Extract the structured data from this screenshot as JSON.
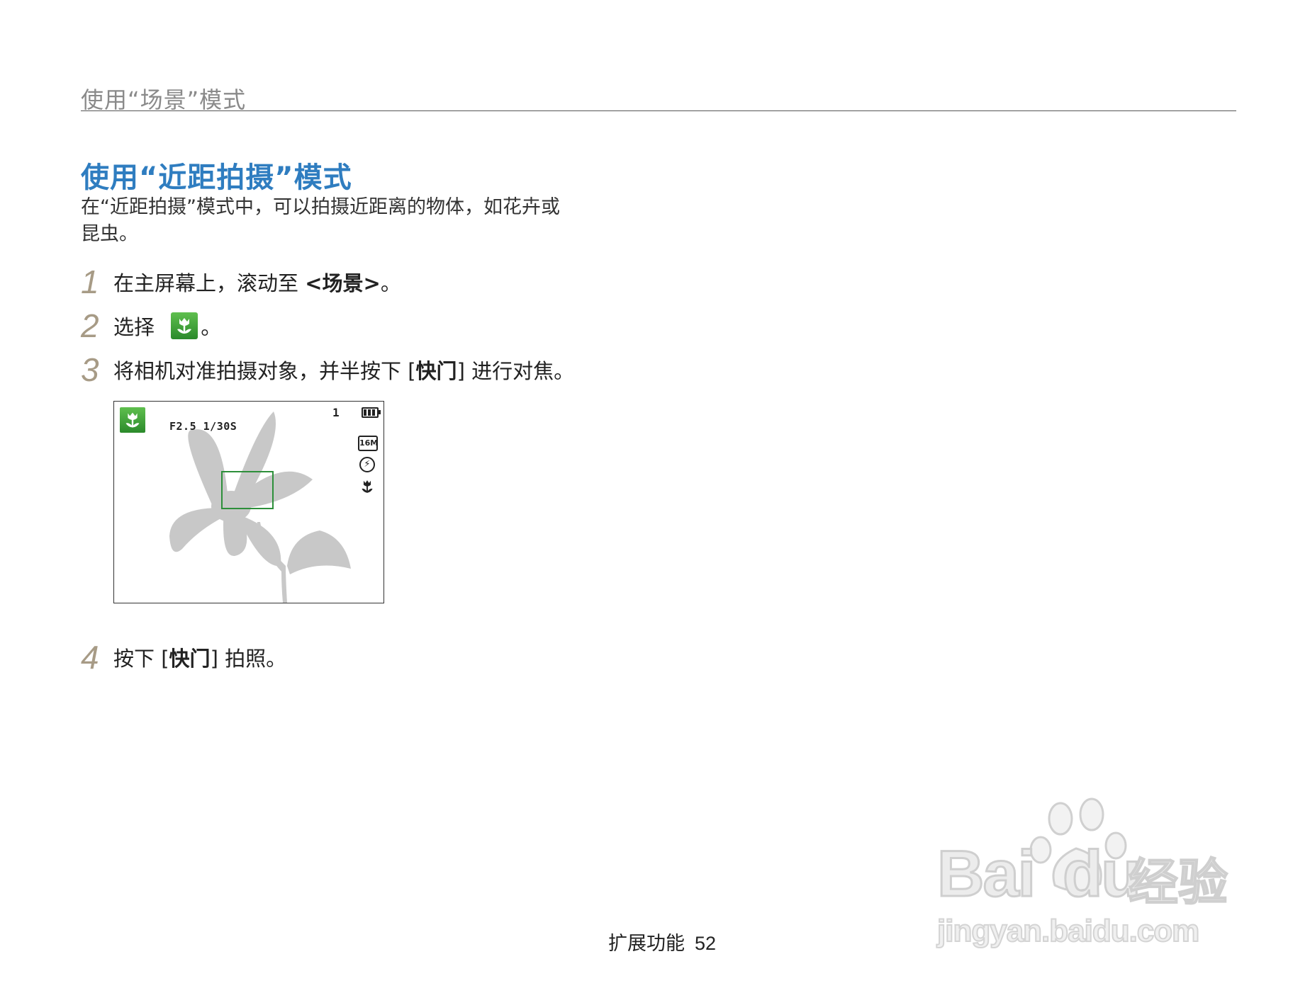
{
  "header": {
    "title": "使用“场景”模式"
  },
  "section": {
    "title": "使用“近距拍摄”模式",
    "intro_line1": "在“近距拍摄”模式中，可以拍摄近距离的物体，如花卉或",
    "intro_line2": "昆虫。"
  },
  "steps": [
    {
      "num": "1",
      "text_before": "在主屏幕上，滚动至 ",
      "bold": "<场景>",
      "text_after": "。"
    },
    {
      "num": "2",
      "text_before": "选择 ",
      "icon": "macro-scene-icon",
      "text_after": "。"
    },
    {
      "num": "3",
      "text_before": "将相机对准拍摄对象，并半按下 [",
      "bold": "快门",
      "text_after": "] 进行对焦。"
    },
    {
      "num": "4",
      "text_before": "按下 [",
      "bold": "快门",
      "text_after": "] 拍照。"
    }
  ],
  "camera_screen": {
    "exposure": "F2.5 1/30S",
    "shots_remaining": "1",
    "resolution_label": "16M",
    "icons": [
      "macro-mode-icon",
      "battery-icon",
      "resolution-icon",
      "flash-off-icon",
      "macro-focus-icon"
    ],
    "accent_color": "#2d8f3a"
  },
  "footer": {
    "section_label": "扩展功能",
    "page_number": "52"
  },
  "watermark": {
    "brand": "Bai",
    "brand_du": "du",
    "suffix": "经验",
    "url": "jingyan.baidu.com"
  },
  "colors": {
    "title_blue": "#2f7dc0",
    "step_number": "#a79b86",
    "header_gray": "#8a8a8a"
  }
}
